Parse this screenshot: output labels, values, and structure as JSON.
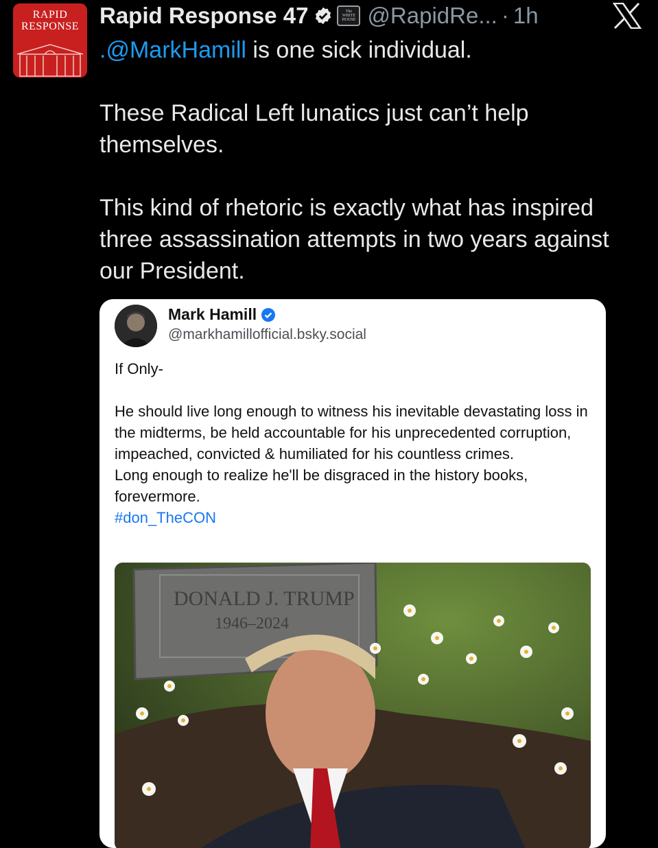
{
  "author": {
    "avatar_text_line1": "RAPID",
    "avatar_text_line2": "RESPONSE",
    "display_name": "Rapid Response 47",
    "verified_icon": "verified-badge-icon",
    "affiliation_badge_text_1": "The",
    "affiliation_badge_text_2": "WHITE",
    "affiliation_badge_text_3": "HOUSE",
    "handle": "@RapidRe...",
    "separator": "·",
    "time": "1h"
  },
  "platform": {
    "logo": "x-logo-icon"
  },
  "tweet": {
    "mention": ".@MarkHamill",
    "line1_rest": " is one sick individual.",
    "paragraph2": "These Radical Left lunatics just can’t help themselves.",
    "paragraph3": "This kind of rhetoric is exactly what has inspired three assassination attempts in two years against our President."
  },
  "quoted_post": {
    "name": "Mark Hamill",
    "handle": "@markhamillofficial.bsky.social",
    "line1": "If Only-",
    "body_1": "He should live long enough to witness his inevitable devastating loss in the midterms, be held accountable for his unprecedented corruption, impeached, convicted & humiliated for his countless crimes.",
    "body_2": "Long enough to realize he'll be disgraced in the history books, forevermore.",
    "hashtag": "#don_TheCON",
    "image": {
      "headstone_line1": "DONALD J. TRUMP",
      "headstone_line2": "1946–2024"
    }
  },
  "colors": {
    "background": "#000000",
    "text": "#e7e9ea",
    "muted": "#8b98a5",
    "link": "#1d9bf0",
    "avatar_red": "#c8201f",
    "card_bg": "#ffffff"
  }
}
